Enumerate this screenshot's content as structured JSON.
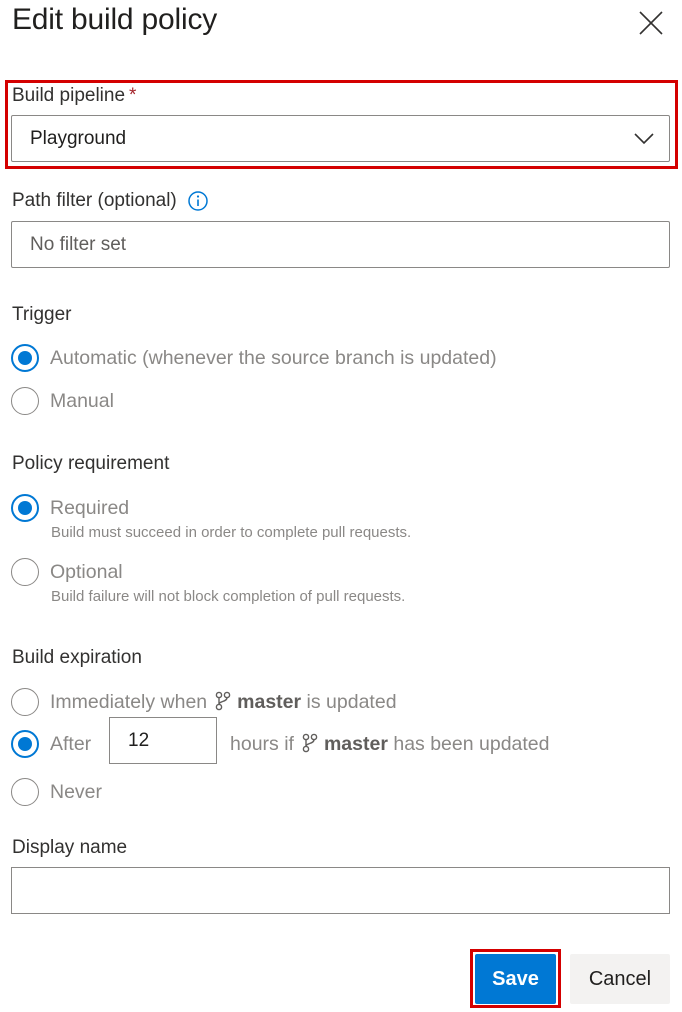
{
  "dialog": {
    "title": "Edit build policy",
    "close_icon": "close-icon"
  },
  "build_pipeline": {
    "label": "Build pipeline",
    "required_marker": "*",
    "value": "Playground",
    "dropdown_icon": "chevron-down-icon"
  },
  "path_filter": {
    "label": "Path filter (optional)",
    "info_icon": "info-icon",
    "placeholder": "No filter set"
  },
  "trigger": {
    "heading": "Trigger",
    "options": [
      {
        "label": "Automatic (whenever the source branch is updated)",
        "selected": true
      },
      {
        "label": "Manual",
        "selected": false
      }
    ]
  },
  "policy_requirement": {
    "heading": "Policy requirement",
    "options": [
      {
        "label": "Required",
        "description": "Build must succeed in order to complete pull requests.",
        "selected": true
      },
      {
        "label": "Optional",
        "description": "Build failure will not block completion of pull requests.",
        "selected": false
      }
    ]
  },
  "build_expiration": {
    "heading": "Build expiration",
    "immediately": {
      "prefix": "Immediately when",
      "branch": "master",
      "suffix": "is updated",
      "selected": false
    },
    "after": {
      "label": "After",
      "hours_value": "12",
      "prefix": "hours if",
      "branch": "master",
      "suffix": "has been updated",
      "selected": true
    },
    "never": {
      "label": "Never",
      "selected": false
    },
    "branch_icon": "git-branch-icon"
  },
  "display_name": {
    "label": "Display name",
    "value": ""
  },
  "footer": {
    "save_label": "Save",
    "cancel_label": "Cancel"
  },
  "colors": {
    "accent": "#0078d4",
    "highlight": "#d40000"
  }
}
